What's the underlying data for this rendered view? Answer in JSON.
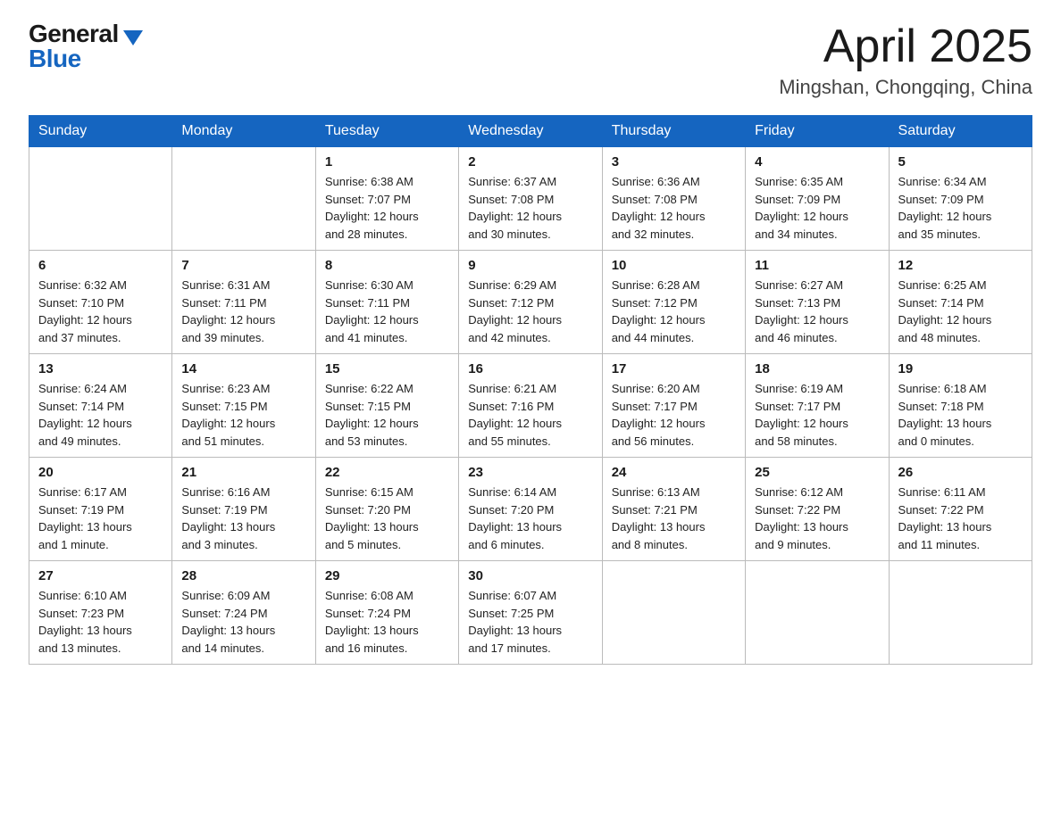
{
  "header": {
    "logo_general": "General",
    "logo_blue": "Blue",
    "month": "April 2025",
    "location": "Mingshan, Chongqing, China"
  },
  "weekdays": [
    "Sunday",
    "Monday",
    "Tuesday",
    "Wednesday",
    "Thursday",
    "Friday",
    "Saturday"
  ],
  "weeks": [
    [
      {
        "day": "",
        "info": ""
      },
      {
        "day": "",
        "info": ""
      },
      {
        "day": "1",
        "info": "Sunrise: 6:38 AM\nSunset: 7:07 PM\nDaylight: 12 hours\nand 28 minutes."
      },
      {
        "day": "2",
        "info": "Sunrise: 6:37 AM\nSunset: 7:08 PM\nDaylight: 12 hours\nand 30 minutes."
      },
      {
        "day": "3",
        "info": "Sunrise: 6:36 AM\nSunset: 7:08 PM\nDaylight: 12 hours\nand 32 minutes."
      },
      {
        "day": "4",
        "info": "Sunrise: 6:35 AM\nSunset: 7:09 PM\nDaylight: 12 hours\nand 34 minutes."
      },
      {
        "day": "5",
        "info": "Sunrise: 6:34 AM\nSunset: 7:09 PM\nDaylight: 12 hours\nand 35 minutes."
      }
    ],
    [
      {
        "day": "6",
        "info": "Sunrise: 6:32 AM\nSunset: 7:10 PM\nDaylight: 12 hours\nand 37 minutes."
      },
      {
        "day": "7",
        "info": "Sunrise: 6:31 AM\nSunset: 7:11 PM\nDaylight: 12 hours\nand 39 minutes."
      },
      {
        "day": "8",
        "info": "Sunrise: 6:30 AM\nSunset: 7:11 PM\nDaylight: 12 hours\nand 41 minutes."
      },
      {
        "day": "9",
        "info": "Sunrise: 6:29 AM\nSunset: 7:12 PM\nDaylight: 12 hours\nand 42 minutes."
      },
      {
        "day": "10",
        "info": "Sunrise: 6:28 AM\nSunset: 7:12 PM\nDaylight: 12 hours\nand 44 minutes."
      },
      {
        "day": "11",
        "info": "Sunrise: 6:27 AM\nSunset: 7:13 PM\nDaylight: 12 hours\nand 46 minutes."
      },
      {
        "day": "12",
        "info": "Sunrise: 6:25 AM\nSunset: 7:14 PM\nDaylight: 12 hours\nand 48 minutes."
      }
    ],
    [
      {
        "day": "13",
        "info": "Sunrise: 6:24 AM\nSunset: 7:14 PM\nDaylight: 12 hours\nand 49 minutes."
      },
      {
        "day": "14",
        "info": "Sunrise: 6:23 AM\nSunset: 7:15 PM\nDaylight: 12 hours\nand 51 minutes."
      },
      {
        "day": "15",
        "info": "Sunrise: 6:22 AM\nSunset: 7:15 PM\nDaylight: 12 hours\nand 53 minutes."
      },
      {
        "day": "16",
        "info": "Sunrise: 6:21 AM\nSunset: 7:16 PM\nDaylight: 12 hours\nand 55 minutes."
      },
      {
        "day": "17",
        "info": "Sunrise: 6:20 AM\nSunset: 7:17 PM\nDaylight: 12 hours\nand 56 minutes."
      },
      {
        "day": "18",
        "info": "Sunrise: 6:19 AM\nSunset: 7:17 PM\nDaylight: 12 hours\nand 58 minutes."
      },
      {
        "day": "19",
        "info": "Sunrise: 6:18 AM\nSunset: 7:18 PM\nDaylight: 13 hours\nand 0 minutes."
      }
    ],
    [
      {
        "day": "20",
        "info": "Sunrise: 6:17 AM\nSunset: 7:19 PM\nDaylight: 13 hours\nand 1 minute."
      },
      {
        "day": "21",
        "info": "Sunrise: 6:16 AM\nSunset: 7:19 PM\nDaylight: 13 hours\nand 3 minutes."
      },
      {
        "day": "22",
        "info": "Sunrise: 6:15 AM\nSunset: 7:20 PM\nDaylight: 13 hours\nand 5 minutes."
      },
      {
        "day": "23",
        "info": "Sunrise: 6:14 AM\nSunset: 7:20 PM\nDaylight: 13 hours\nand 6 minutes."
      },
      {
        "day": "24",
        "info": "Sunrise: 6:13 AM\nSunset: 7:21 PM\nDaylight: 13 hours\nand 8 minutes."
      },
      {
        "day": "25",
        "info": "Sunrise: 6:12 AM\nSunset: 7:22 PM\nDaylight: 13 hours\nand 9 minutes."
      },
      {
        "day": "26",
        "info": "Sunrise: 6:11 AM\nSunset: 7:22 PM\nDaylight: 13 hours\nand 11 minutes."
      }
    ],
    [
      {
        "day": "27",
        "info": "Sunrise: 6:10 AM\nSunset: 7:23 PM\nDaylight: 13 hours\nand 13 minutes."
      },
      {
        "day": "28",
        "info": "Sunrise: 6:09 AM\nSunset: 7:24 PM\nDaylight: 13 hours\nand 14 minutes."
      },
      {
        "day": "29",
        "info": "Sunrise: 6:08 AM\nSunset: 7:24 PM\nDaylight: 13 hours\nand 16 minutes."
      },
      {
        "day": "30",
        "info": "Sunrise: 6:07 AM\nSunset: 7:25 PM\nDaylight: 13 hours\nand 17 minutes."
      },
      {
        "day": "",
        "info": ""
      },
      {
        "day": "",
        "info": ""
      },
      {
        "day": "",
        "info": ""
      }
    ]
  ]
}
